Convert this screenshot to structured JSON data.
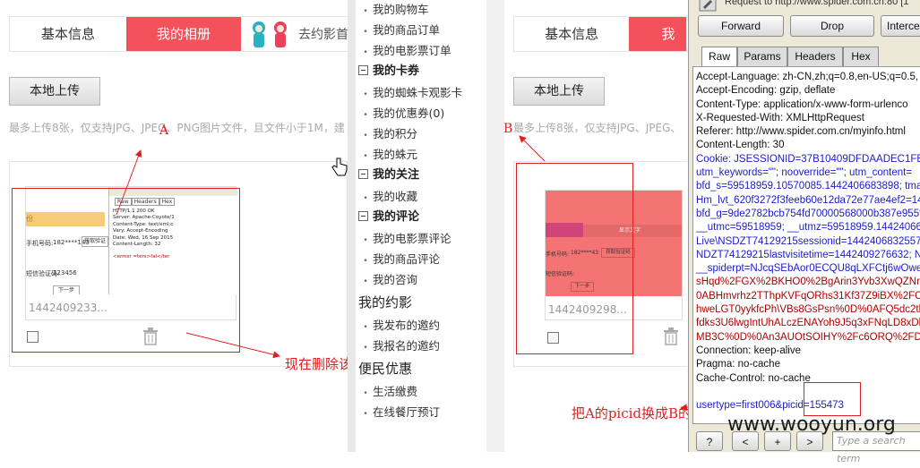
{
  "left": {
    "tabs": [
      {
        "label": "基本信息"
      },
      {
        "label": "我的相册"
      }
    ],
    "invite_text": "去约影首",
    "upload_label": "本地上传",
    "hint": "最多上传8张，仅支持JPG、JPEG、PNG图片文件，且文件小于1M，建",
    "photo_name": "1442409233...",
    "annot_letter": "A",
    "annot_delete": "现在删除该图片",
    "mini": {
      "tabs": [
        "Raw",
        "Headers",
        "Hex"
      ],
      "lines": [
        "HTTP/1.1 200 OK",
        "Server: Apache-Coyote/1",
        "Content-Type: text/xml;c",
        "Vary: Accept-Encoding",
        "Date: Wed, 16 Sep 2015",
        "Content-Length: 32",
        "",
        "<ermsr =ters>fal</ter"
      ],
      "phone_label": "手机号码:",
      "phone": "182****143",
      "code_btn": "获取验证",
      "sms_label": "短信验证码:",
      "sms": "123456",
      "next": "下一步"
    }
  },
  "menu": {
    "sections": [
      {
        "type": "item",
        "label": "我的购物车"
      },
      {
        "type": "item",
        "label": "我的商品订单"
      },
      {
        "type": "item",
        "label": "我的电影票订单"
      },
      {
        "type": "head",
        "label": "我的卡券"
      },
      {
        "type": "item",
        "label": "我的蜘蛛卡观影卡"
      },
      {
        "type": "item",
        "label": "我的优惠券(0)"
      },
      {
        "type": "item",
        "label": "我的积分"
      },
      {
        "type": "item",
        "label": "我的蛛元"
      },
      {
        "type": "head",
        "label": "我的关注"
      },
      {
        "type": "item",
        "label": "我的收藏"
      },
      {
        "type": "head",
        "label": "我的评论"
      },
      {
        "type": "item",
        "label": "我的电影票评论"
      },
      {
        "type": "item",
        "label": "我的商品评论"
      },
      {
        "type": "item",
        "label": "我的咨询"
      },
      {
        "type": "big",
        "label": "我的约影"
      },
      {
        "type": "item",
        "label": "我发布的邀约"
      },
      {
        "type": "item",
        "label": "我报名的邀约"
      },
      {
        "type": "big",
        "label": "便民优惠"
      },
      {
        "type": "item",
        "label": "生活缴费"
      },
      {
        "type": "item",
        "label": "在线餐厅预订"
      }
    ]
  },
  "right_page": {
    "tabs": [
      {
        "label": "基本信息"
      },
      {
        "label": "我的"
      }
    ],
    "upload_label": "本地上传",
    "hint": "最多上传8张，仅支持JPG、JPEG、",
    "photo_name": "1442409298...",
    "annot_letter": "B",
    "annot_swap": "把A的picid换成B的picid",
    "mini": {
      "label": "显示文字",
      "phone_label": "手机号码:",
      "phone": "182****43",
      "btn": "获取验证码",
      "sms_label": "短信验证码:",
      "next": "下一步"
    }
  },
  "burp": {
    "request_title": "Request to http://www.spider.com.cn:80 [1",
    "buttons": {
      "forward": "Forward",
      "drop": "Drop",
      "intercept": "Interce"
    },
    "tabs": [
      "Raw",
      "Params",
      "Headers",
      "Hex"
    ],
    "lines": [
      {
        "t": "Accept-Language: zh-CN,zh;q=0.8,en-US;q=0.5,",
        "c": ""
      },
      {
        "t": "Accept-Encoding: gzip, deflate",
        "c": ""
      },
      {
        "t": "Content-Type: application/x-www-form-urlenco",
        "c": ""
      },
      {
        "t": "X-Requested-With: XMLHttpRequest",
        "c": ""
      },
      {
        "t": "Referer: http://www.spider.com.cn/myinfo.html",
        "c": ""
      },
      {
        "t": "Content-Length: 30",
        "c": ""
      },
      {
        "t": "Cookie: JSESSIONID=37B10409DFDAADEC1FBCF",
        "c": "bl"
      },
      {
        "t": "utm_keywords=\"\"; nooverride=\"\"; utm_content=",
        "c": "bl"
      },
      {
        "t": "bfd_s=59518959.10570085.1442406683898; tma=5",
        "c": "bl"
      },
      {
        "t": "Hm_lvt_620f3272f3feeb60e12da72e77ae4ef2=144",
        "c": "bl"
      },
      {
        "t": "bfd_g=9de2782bcb754fd70000568000b387e955f3",
        "c": "bl"
      },
      {
        "t": "__utmc=59518959; __utmz=59518959.1442406691",
        "c": "bl"
      },
      {
        "t": "Live\\NSDZT74129215sessionid=144240683255738",
        "c": "bl"
      },
      {
        "t": "NDZT74129215lastvisitetime=1442409276632; ND",
        "c": "bl"
      },
      {
        "t": "__spiderpt=NJcqSEbAor0ECQU8qLXFCtj6wOwe5",
        "c": "bl"
      },
      {
        "t": "sHqd%2FGX%2BKHO0%2BgArin3Yvb3XwQZNm",
        "c": "rd"
      },
      {
        "t": "0ABHmvrhz2TThpKVFqORhs31Kf37Z9iBX%2FCel",
        "c": "rd"
      },
      {
        "t": "hweLGT0yykfcPh\\VBs8GsPsn%0D%0AFQ5dc2tlC",
        "c": "rd"
      },
      {
        "t": "fdks3U6lwgIntUhALczENAYoh9J5q3xFNqLD8xDl",
        "c": "rd"
      },
      {
        "t": "MB3C%0D%0An3AUOtSOIHY%2Fc6ORQ%2FDw",
        "c": "rd"
      },
      {
        "t": "Connection: keep-alive",
        "c": ""
      },
      {
        "t": "Pragma: no-cache",
        "c": ""
      },
      {
        "t": "Cache-Control: no-cache",
        "c": ""
      },
      {
        "t": "",
        "c": ""
      },
      {
        "t": "usertype=first006&picid=155473",
        "c": "bl"
      }
    ],
    "nav": [
      "?",
      "<",
      "+",
      ">"
    ],
    "search_placeholder": "Type a search term"
  },
  "watermark": "www.wooyun.org",
  "colors": {
    "accent": "#f3525a",
    "annotation": "#e02020",
    "link": "#1c1ccc"
  }
}
